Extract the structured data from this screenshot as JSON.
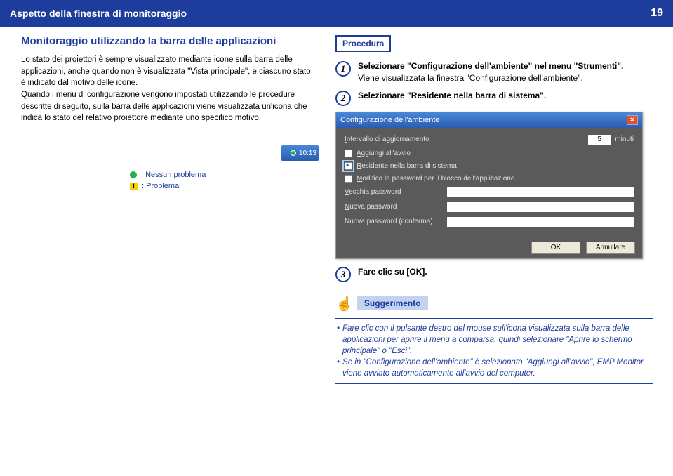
{
  "header": {
    "title": "Aspetto della finestra di monitoraggio",
    "page": "19"
  },
  "left": {
    "section_title": "Monitoraggio utilizzando la barra delle applicazioni",
    "paragraph": "Lo stato dei proiettori è sempre visualizzato mediante icone sulla barra delle applicazioni, anche quando non è visualizzata \"Vista principale\", e ciascuno stato è indicato dal motivo delle icone.\nQuando i menu di configurazione vengono impostati utilizzando le procedure descritte di seguito, sulla barra delle applicazioni viene visualizzata un'icona che indica lo stato del relativo proiettore mediante uno specifico motivo.",
    "taskbar_time": "10:13",
    "legend_ok": ": Nessun problema",
    "legend_problem": ": Problema"
  },
  "right": {
    "procedure_label": "Procedura",
    "steps": [
      {
        "num": "1",
        "bold": "Selezionare \"Configurazione dell'ambiente\" nel menu \"Strumenti\".",
        "plain": "Viene visualizzata la finestra \"Configurazione dell'ambiente\"."
      },
      {
        "num": "2",
        "bold": "Selezionare \"Residente nella barra di sistema\".",
        "plain": ""
      },
      {
        "num": "3",
        "bold": "Fare clic su [OK].",
        "plain": ""
      }
    ],
    "dialog": {
      "title": "Configurazione dell'ambiente",
      "interval_label": "Intervallo di aggiornamento",
      "interval_value": "5",
      "interval_unit": "minuti",
      "cb_startup": "Aggiungi all'avvio",
      "cb_systray": "Residente nella barra di sistema",
      "cb_modpwd": "Modifica la password per il blocco dell'applicazione.",
      "old_pwd": "Vecchia password",
      "new_pwd": "Nuova password",
      "new_pwd_conf": "Nuova password (conferma)",
      "btn_ok": "OK",
      "btn_cancel": "Annullare"
    },
    "tip": {
      "label": "Suggerimento",
      "line1": "Fare clic con il pulsante destro del mouse sull'icona visualizzata sulla barra delle applicazioni per aprire il menu a comparsa, quindi selezionare \"Aprire lo schermo principale\" o \"Esci\".",
      "line2": "Se in \"Configurazione dell'ambiente\" è selezionato \"Aggiungi all'avvio\", EMP Monitor viene avviato automaticamente all'avvio del computer."
    }
  }
}
